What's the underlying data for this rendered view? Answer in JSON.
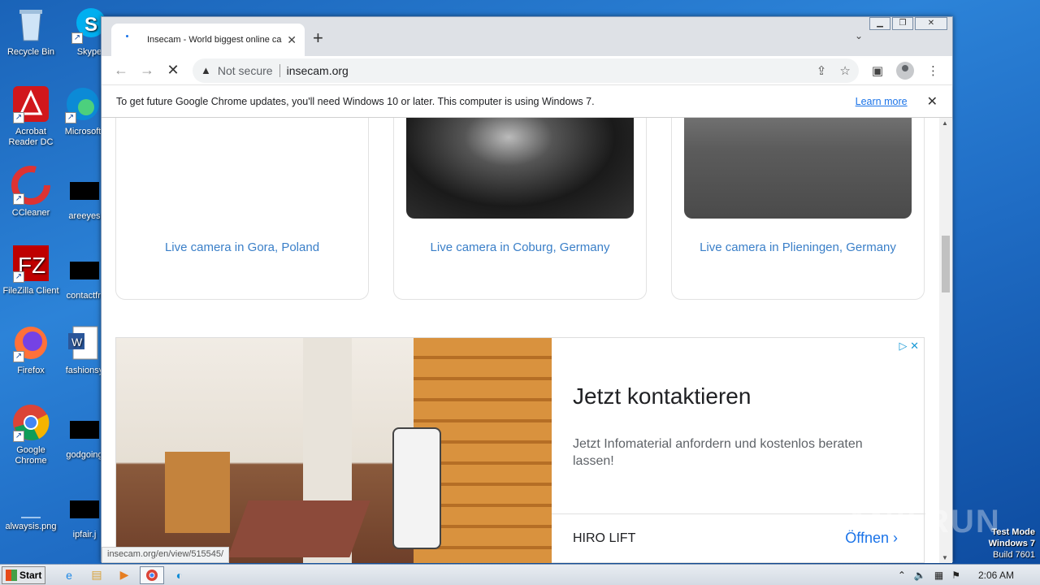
{
  "desktop": {
    "icons": [
      {
        "label": "Recycle Bin",
        "icon": "recycle-bin-icon"
      },
      {
        "label": "Skype",
        "icon": "skype-icon"
      },
      {
        "label": "Acrobat Reader DC",
        "icon": "acrobat-icon"
      },
      {
        "label": "Microsoft",
        "icon": "edge-icon"
      },
      {
        "label": "CCleaner",
        "icon": "ccleaner-icon"
      },
      {
        "label": "areeyes",
        "icon": "file-icon"
      },
      {
        "label": "FileZilla Client",
        "icon": "filezilla-icon"
      },
      {
        "label": "contactfri",
        "icon": "file-icon"
      },
      {
        "label": "Firefox",
        "icon": "firefox-icon"
      },
      {
        "label": "fashionsy",
        "icon": "word-doc-icon"
      },
      {
        "label": "Google Chrome",
        "icon": "chrome-icon"
      },
      {
        "label": "godgoing",
        "icon": "file-icon"
      },
      {
        "label": "alwaysis.png",
        "icon": "image-file-icon"
      },
      {
        "label": "ipfair.j",
        "icon": "file-icon"
      }
    ]
  },
  "browser": {
    "tab_title": "Insecam - World biggest online came",
    "url_security": "Not secure",
    "url": "insecam.org",
    "infobar_message": "To get future Google Chrome updates, you'll need Windows 10 or later. This computer is using Windows 7.",
    "infobar_link": "Learn more",
    "status_url": "insecam.org/en/view/515545/"
  },
  "page": {
    "cameras": [
      {
        "label": "Live camera in Gora, Poland"
      },
      {
        "label": "Live camera in Coburg, Germany"
      },
      {
        "label": "Live camera in Plieningen, Germany"
      }
    ],
    "ad": {
      "title": "Jetzt kontaktieren",
      "description": "Jetzt Infomaterial anfordern und kostenlos beraten lassen!",
      "brand": "HIRO LIFT",
      "cta": "Öffnen"
    }
  },
  "system": {
    "watermark": "ANY.RUN",
    "test_mode": "Test Mode",
    "os_name": "Windows 7",
    "build": "Build 7601",
    "start_label": "Start",
    "clock": "2:06 AM"
  }
}
